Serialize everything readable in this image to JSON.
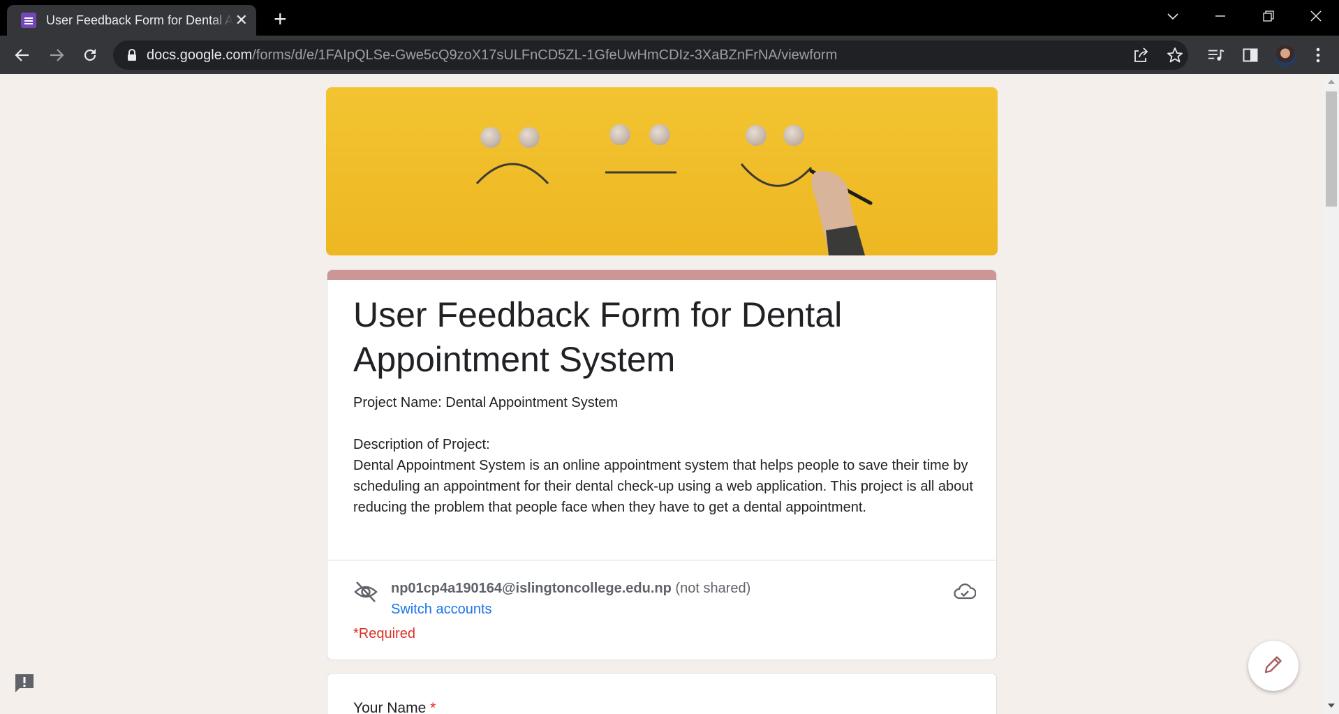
{
  "browser": {
    "tab_title": "User Feedback Form for Dental Appointment System",
    "tab_close": "✕",
    "new_tab": "+",
    "url_host": "docs.google.com",
    "url_path": "/forms/d/e/1FAIpQLSe-Gwe5cQ9zoX17sULFnCD5ZL-1GfeUwHmCDIz-3XaBZnFrNA/viewform",
    "icons": [
      "back-arrow-icon",
      "forward-arrow-icon",
      "reload-icon",
      "lock-icon",
      "share-icon",
      "star-bookmark-icon",
      "media-controls-icon",
      "side-panel-icon",
      "profile-avatar",
      "kebab-menu-icon"
    ],
    "window_controls": [
      "tab-search-chevron-icon",
      "minimize-icon",
      "restore-icon",
      "close-window-icon"
    ]
  },
  "form": {
    "title": "User Feedback Form for Dental Appointment System",
    "description": "Project Name: Dental Appointment System\n\nDescription of Project:\nDental Appointment System is an online appointment system that helps people to save their time by scheduling an appointment for their dental check-up using a web application. This project is all about reducing the problem that people face when they have to get a dental appointment.",
    "account_email": "np01cp4a190164@islingtoncollege.edu.np",
    "account_status": "(not shared)",
    "switch_accounts": "Switch accounts",
    "required_note": "*Required",
    "first_question": "Your Name",
    "required_star": "*"
  },
  "colors": {
    "theme_stripe": "#cd9696",
    "banner_yellow": "#f0bd2a",
    "link": "#1a73e8",
    "required": "#d93025"
  }
}
